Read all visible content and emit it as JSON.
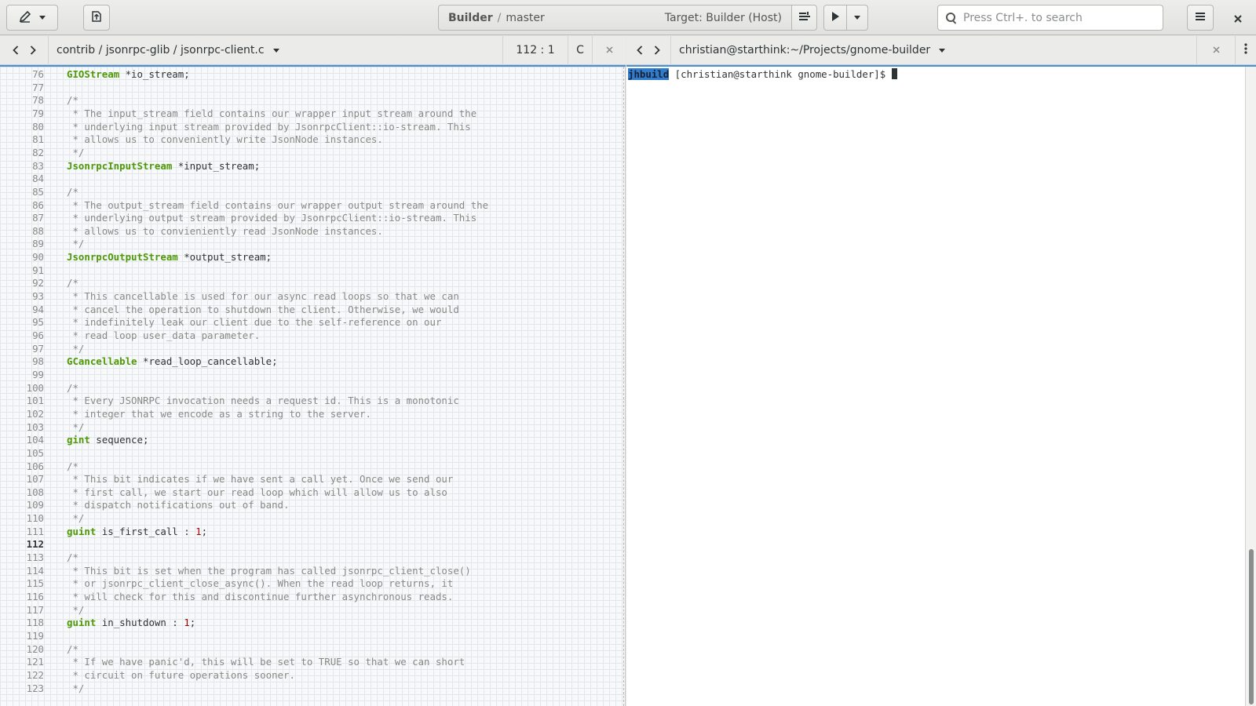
{
  "header": {
    "project": "Builder",
    "separator": "/",
    "branch": "master",
    "target": "Target: Builder (Host)",
    "search_placeholder": "Press Ctrl+. to search"
  },
  "editor": {
    "path": "contrib / jsonrpc-glib / jsonrpc-client.c",
    "position": "112 : 1",
    "language": "C",
    "current_line": "112",
    "lines": [
      {
        "n": "76",
        "parts": [
          [
            "ty",
            "GIOStream"
          ],
          [
            "t",
            " *io_stream;"
          ]
        ]
      },
      {
        "n": "77",
        "parts": []
      },
      {
        "n": "78",
        "parts": [
          [
            "cm",
            "/*"
          ]
        ]
      },
      {
        "n": "79",
        "parts": [
          [
            "cm",
            " * The input_stream field contains our wrapper input stream around the"
          ]
        ]
      },
      {
        "n": "80",
        "parts": [
          [
            "cm",
            " * underlying input stream provided by JsonrpcClient::io-stream. This"
          ]
        ]
      },
      {
        "n": "81",
        "parts": [
          [
            "cm",
            " * allows us to conveniently write JsonNode instances."
          ]
        ]
      },
      {
        "n": "82",
        "parts": [
          [
            "cm",
            " */"
          ]
        ]
      },
      {
        "n": "83",
        "parts": [
          [
            "ty",
            "JsonrpcInputStream"
          ],
          [
            "t",
            " *input_stream;"
          ]
        ]
      },
      {
        "n": "84",
        "parts": []
      },
      {
        "n": "85",
        "parts": [
          [
            "cm",
            "/*"
          ]
        ]
      },
      {
        "n": "86",
        "parts": [
          [
            "cm",
            " * The output_stream field contains our wrapper output stream around the"
          ]
        ]
      },
      {
        "n": "87",
        "parts": [
          [
            "cm",
            " * underlying output stream provided by JsonrpcClient::io-stream. This"
          ]
        ]
      },
      {
        "n": "88",
        "parts": [
          [
            "cm",
            " * allows us to convieniently read JsonNode instances."
          ]
        ]
      },
      {
        "n": "89",
        "parts": [
          [
            "cm",
            " */"
          ]
        ]
      },
      {
        "n": "90",
        "parts": [
          [
            "ty",
            "JsonrpcOutputStream"
          ],
          [
            "t",
            " *output_stream;"
          ]
        ]
      },
      {
        "n": "91",
        "parts": []
      },
      {
        "n": "92",
        "parts": [
          [
            "cm",
            "/*"
          ]
        ]
      },
      {
        "n": "93",
        "parts": [
          [
            "cm",
            " * This cancellable is used for our async read loops so that we can"
          ]
        ]
      },
      {
        "n": "94",
        "parts": [
          [
            "cm",
            " * cancel the operation to shutdown the client. Otherwise, we would"
          ]
        ]
      },
      {
        "n": "95",
        "parts": [
          [
            "cm",
            " * indefinitely leak our client due to the self-reference on our"
          ]
        ]
      },
      {
        "n": "96",
        "parts": [
          [
            "cm",
            " * read loop user_data parameter."
          ]
        ]
      },
      {
        "n": "97",
        "parts": [
          [
            "cm",
            " */"
          ]
        ]
      },
      {
        "n": "98",
        "parts": [
          [
            "ty",
            "GCancellable"
          ],
          [
            "t",
            " *read_loop_cancellable;"
          ]
        ]
      },
      {
        "n": "99",
        "parts": []
      },
      {
        "n": "100",
        "parts": [
          [
            "cm",
            "/*"
          ]
        ]
      },
      {
        "n": "101",
        "parts": [
          [
            "cm",
            " * Every JSONRPC invocation needs a request id. This is a monotonic"
          ]
        ]
      },
      {
        "n": "102",
        "parts": [
          [
            "cm",
            " * integer that we encode as a string to the server."
          ]
        ]
      },
      {
        "n": "103",
        "parts": [
          [
            "cm",
            " */"
          ]
        ]
      },
      {
        "n": "104",
        "parts": [
          [
            "ty",
            "gint"
          ],
          [
            "t",
            " sequence;"
          ]
        ]
      },
      {
        "n": "105",
        "parts": []
      },
      {
        "n": "106",
        "parts": [
          [
            "cm",
            "/*"
          ]
        ]
      },
      {
        "n": "107",
        "parts": [
          [
            "cm",
            " * This bit indicates if we have sent a call yet. Once we send our"
          ]
        ]
      },
      {
        "n": "108",
        "parts": [
          [
            "cm",
            " * first call, we start our read loop which will allow us to also"
          ]
        ]
      },
      {
        "n": "109",
        "parts": [
          [
            "cm",
            " * dispatch notifications out of band."
          ]
        ]
      },
      {
        "n": "110",
        "parts": [
          [
            "cm",
            " */"
          ]
        ]
      },
      {
        "n": "111",
        "parts": [
          [
            "ty",
            "guint"
          ],
          [
            "t",
            " is_first_call : "
          ],
          [
            "num2",
            "1"
          ],
          [
            "t",
            ";"
          ]
        ]
      },
      {
        "n": "112",
        "parts": []
      },
      {
        "n": "113",
        "parts": [
          [
            "cm",
            "/*"
          ]
        ]
      },
      {
        "n": "114",
        "parts": [
          [
            "cm",
            " * This bit is set when the program has called jsonrpc_client_close()"
          ]
        ]
      },
      {
        "n": "115",
        "parts": [
          [
            "cm",
            " * or jsonrpc_client_close_async(). When the read loop returns, it"
          ]
        ]
      },
      {
        "n": "116",
        "parts": [
          [
            "cm",
            " * will check for this and discontinue further asynchronous reads."
          ]
        ]
      },
      {
        "n": "117",
        "parts": [
          [
            "cm",
            " */"
          ]
        ]
      },
      {
        "n": "118",
        "parts": [
          [
            "ty",
            "guint"
          ],
          [
            "t",
            " in_shutdown : "
          ],
          [
            "num2",
            "1"
          ],
          [
            "t",
            ";"
          ]
        ]
      },
      {
        "n": "119",
        "parts": []
      },
      {
        "n": "120",
        "parts": [
          [
            "cm",
            "/*"
          ]
        ]
      },
      {
        "n": "121",
        "parts": [
          [
            "cm",
            " * If we have panic'd, this will be set to TRUE so that we can short"
          ]
        ]
      },
      {
        "n": "122",
        "parts": [
          [
            "cm",
            " * circuit on future operations sooner."
          ]
        ]
      },
      {
        "n": "123",
        "parts": [
          [
            "cm",
            " */"
          ]
        ]
      }
    ]
  },
  "terminal": {
    "title": "christian@starthink:~/Projects/gnome-builder",
    "badge": "jhbuild",
    "prompt": " [christian@starthink gnome-builder]$ "
  }
}
